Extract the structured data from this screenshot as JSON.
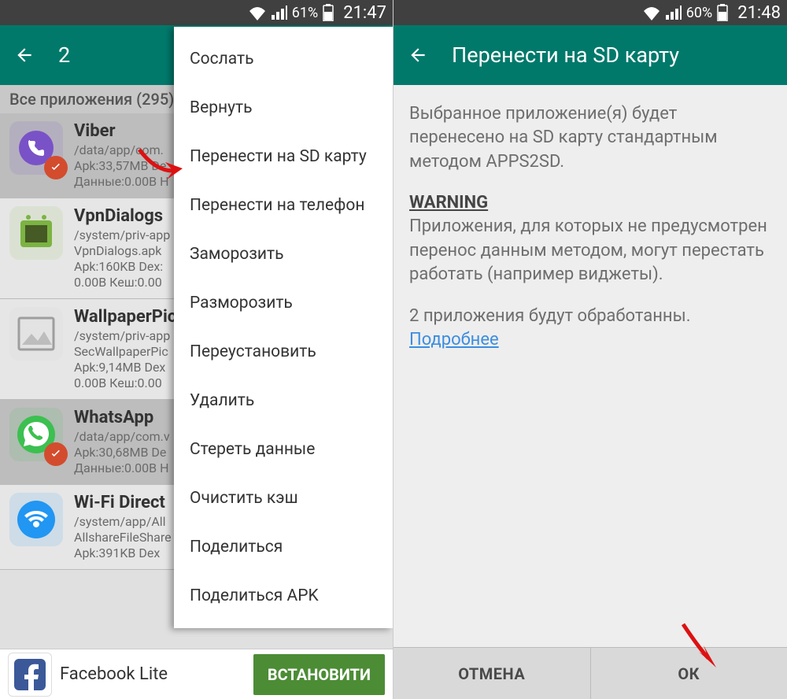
{
  "left": {
    "status": {
      "battery": "61%",
      "time": "21:47"
    },
    "appbar_title": "2",
    "section_header": "Все приложения (295)",
    "apps": [
      {
        "name": "Viber",
        "path": "/data/app/com.",
        "line2": "Apk:33,57MB  De",
        "line3": "Данные:0.00B  H",
        "icon_bg": "#7a52c7",
        "selected": true,
        "checked": true
      },
      {
        "name": "VpnDialogs",
        "path": "/system/priv-app",
        "line2": "VpnDialogs.apk",
        "line3": "Apk:160KB  Dex:",
        "line4": "0.00B  Кеш:0.00",
        "icon_bg": "#8ac24a",
        "selected": false,
        "checked": false
      },
      {
        "name": "WallpaperPic",
        "path": "/system/priv-app",
        "line2": "SecWallpaperPic",
        "line3": "Apk:9,14MB  Dex",
        "line4": "0.00B  Кеш:0.00",
        "icon_bg": "#d0d0d0",
        "selected": false,
        "checked": false
      },
      {
        "name": "WhatsApp",
        "path": "/data/app/com.v",
        "line2": "Apk:30,68MB  De",
        "line3": "Данные:0.00B  H",
        "icon_bg": "#3cc050",
        "selected": true,
        "checked": true
      },
      {
        "name": "Wi-Fi Direct",
        "path": "/system/app/All",
        "line2": "AllshareFileShare",
        "line3": "Apk:391KB  Dex",
        "icon_bg": "#2196f3",
        "selected": false,
        "checked": false
      }
    ],
    "menu": {
      "items": [
        "Сослать",
        "Вернуть",
        "Перенести на SD карту",
        "Перенести на телефон",
        "Заморозить",
        "Разморозить",
        "Переустановить",
        "Удалить",
        "Стереть данные",
        "Очистить кэш",
        "Поделиться",
        "Поделиться APK"
      ]
    },
    "ad": {
      "text": "Facebook Lite",
      "button": "ВСТАНОВИТИ"
    }
  },
  "right": {
    "status": {
      "battery": "60%",
      "time": "21:48"
    },
    "appbar_title": "Перенести на SD карту",
    "body": {
      "p1": "Выбранное приложение(я) будет перенесено на SD карту стандартным методом APPS2SD.",
      "warning_title": "WARNING",
      "warning_text": "Приложения, для которых не предусмотрен перенос данным методом, могут перестать работать (например виджеты).",
      "p3a": "2 приложения будут обработанны.",
      "link": "Подробнее"
    },
    "buttons": {
      "cancel": "ОТМЕНА",
      "ok": "ОК"
    }
  }
}
